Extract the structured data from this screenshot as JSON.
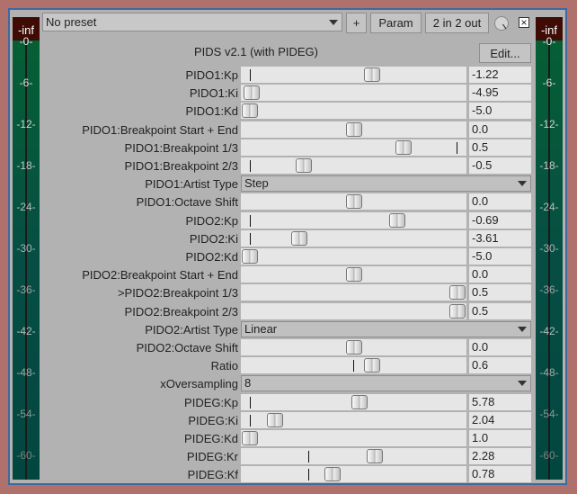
{
  "header": {
    "preset": "No preset",
    "plus_label": "+",
    "param_label": "Param",
    "io_label": "2 in 2 out",
    "close_label": "×"
  },
  "plugin": {
    "title": "PIDS v2.1 (with PIDEG)",
    "edit_label": "Edit..."
  },
  "meter": {
    "peak": "-inf",
    "ticks": [
      "-0-",
      "-6-",
      "-12-",
      "-18-",
      "-24-",
      "-30-",
      "-36-",
      "-42-",
      "-48-",
      "-54-",
      "-60-"
    ]
  },
  "params": [
    {
      "label": "PIDO1:Kp",
      "type": "slider",
      "value": "-1.22",
      "pos": 0.59,
      "default": 0.04
    },
    {
      "label": "PIDO1:Ki",
      "type": "slider",
      "value": "-4.95",
      "pos": 0.01,
      "default": null
    },
    {
      "label": "PIDO1:Kd",
      "type": "slider",
      "value": "-5.0",
      "pos": 0.0,
      "default": null
    },
    {
      "label": "PIDO1:Breakpoint Start + End",
      "type": "slider",
      "value": "0.0",
      "pos": 0.5,
      "default": null
    },
    {
      "label": "PIDO1:Breakpoint 1/3",
      "type": "slider",
      "value": "0.5",
      "pos": 0.74,
      "default": 0.96
    },
    {
      "label": "PIDO1:Breakpoint 2/3",
      "type": "slider",
      "value": "-0.5",
      "pos": 0.26,
      "default": 0.04
    },
    {
      "label": "PIDO1:Artist Type",
      "type": "dropdown",
      "value": "Step"
    },
    {
      "label": "PIDO1:Octave Shift",
      "type": "slider",
      "value": "0.0",
      "pos": 0.5,
      "default": null
    },
    {
      "label": "PIDO2:Kp",
      "type": "slider",
      "value": "-0.69",
      "pos": 0.71,
      "default": 0.04
    },
    {
      "label": "PIDO2:Ki",
      "type": "slider",
      "value": "-3.61",
      "pos": 0.24,
      "default": 0.04
    },
    {
      "label": "PIDO2:Kd",
      "type": "slider",
      "value": "-5.0",
      "pos": 0.0,
      "default": null
    },
    {
      "label": "PIDO2:Breakpoint Start + End",
      "type": "slider",
      "value": "0.0",
      "pos": 0.5,
      "default": null
    },
    {
      "label": ">PIDO2:Breakpoint 1/3",
      "type": "slider",
      "value": "0.5",
      "pos": 1.0,
      "default": null
    },
    {
      "label": "PIDO2:Breakpoint 2/3",
      "type": "slider",
      "value": "0.5",
      "pos": 1.0,
      "default": null
    },
    {
      "label": "PIDO2:Artist Type",
      "type": "dropdown",
      "value": "Linear"
    },
    {
      "label": "PIDO2:Octave Shift",
      "type": "slider",
      "value": "0.0",
      "pos": 0.5,
      "default": null
    },
    {
      "label": "Ratio",
      "type": "slider",
      "value": "0.6",
      "pos": 0.59,
      "default": 0.5
    },
    {
      "label": "xOversampling",
      "type": "dropdown",
      "value": "8"
    },
    {
      "label": "PIDEG:Kp",
      "type": "slider",
      "value": "5.78",
      "pos": 0.53,
      "default": 0.04
    },
    {
      "label": "PIDEG:Ki",
      "type": "slider",
      "value": "2.04",
      "pos": 0.12,
      "default": 0.04
    },
    {
      "label": "PIDEG:Kd",
      "type": "slider",
      "value": "1.0",
      "pos": 0.0,
      "default": null
    },
    {
      "label": "PIDEG:Kr",
      "type": "slider",
      "value": "2.28",
      "pos": 0.6,
      "default": 0.3
    },
    {
      "label": "PIDEG:Kf",
      "type": "slider",
      "value": "0.78",
      "pos": 0.4,
      "default": 0.3
    }
  ]
}
